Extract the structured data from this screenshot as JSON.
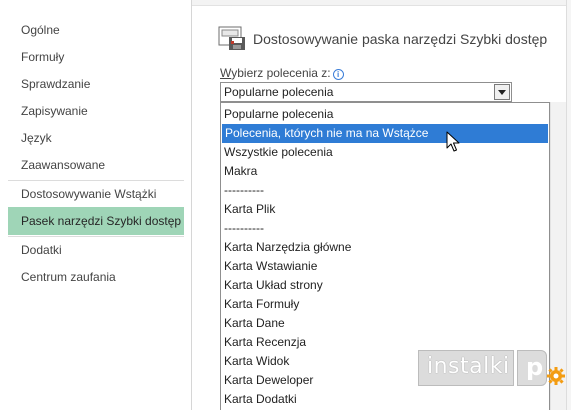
{
  "sidebar": {
    "items": [
      {
        "label": "Ogólne"
      },
      {
        "label": "Formuły"
      },
      {
        "label": "Sprawdzanie"
      },
      {
        "label": "Zapisywanie"
      },
      {
        "label": "Język"
      },
      {
        "label": "Zaawansowane"
      },
      {
        "label": "Dostosowywanie Wstążki"
      },
      {
        "label": "Pasek narzędzi Szybki dostęp",
        "selected": true
      },
      {
        "label": "Dodatki"
      },
      {
        "label": "Centrum zaufania"
      }
    ]
  },
  "main": {
    "title": "Dostosowywanie paska narzędzi Szybki dostęp",
    "choose_label_first": "W",
    "choose_label_rest": "ybierz polecenia z:",
    "choose_combo_value": "Popularne polecenia",
    "dropdown": {
      "items": [
        {
          "label": "Popularne polecenia"
        },
        {
          "label": "Polecenia, których nie ma na Wstążce",
          "highlighted": true
        },
        {
          "label": "Wszystkie polecenia"
        },
        {
          "label": "Makra"
        },
        {
          "label": "----------"
        },
        {
          "label": "Karta Plik"
        },
        {
          "label": "----------"
        },
        {
          "label": "Karta Narzędzia główne"
        },
        {
          "label": "Karta Wstawianie"
        },
        {
          "label": "Karta Układ strony"
        },
        {
          "label": "Karta Formuły"
        },
        {
          "label": "Karta Dane"
        },
        {
          "label": "Karta Recenzja"
        },
        {
          "label": "Karta Widok"
        },
        {
          "label": "Karta Deweloper"
        },
        {
          "label": "Karta Dodatki"
        }
      ]
    }
  },
  "watermark": {
    "text": "instalki",
    "letter": "p"
  },
  "colors": {
    "selected_sidebar": "#9fd5b7",
    "highlight": "#2f7cd5"
  }
}
